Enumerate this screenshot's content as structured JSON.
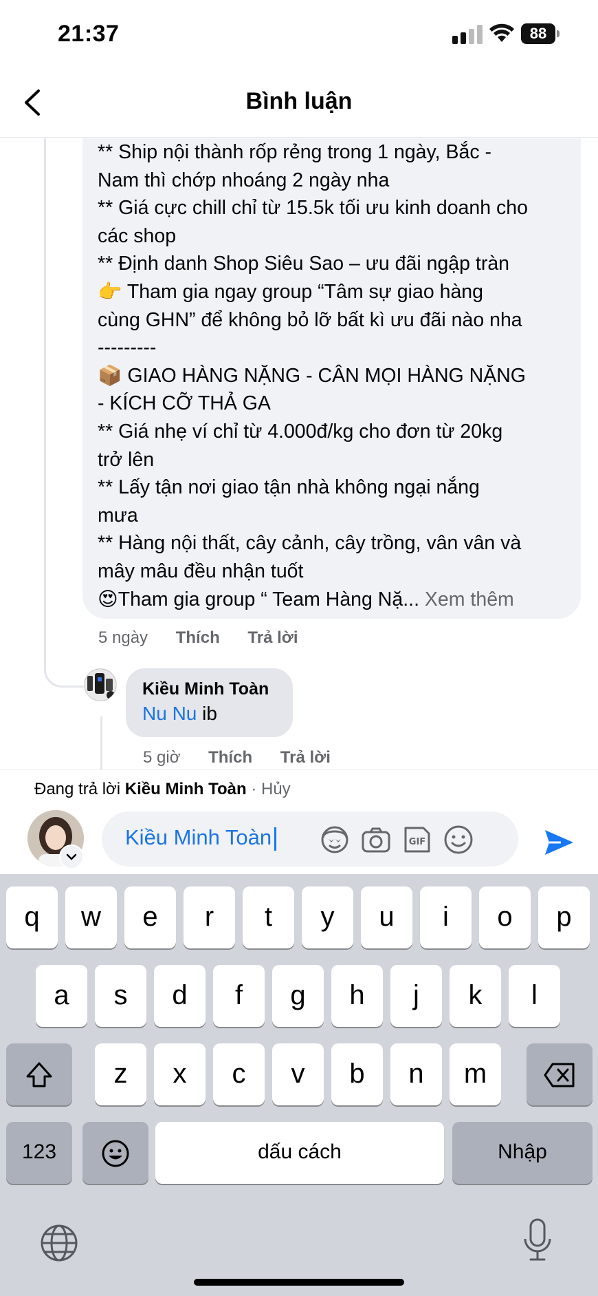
{
  "status_bar": {
    "time": "21:37",
    "battery": "88"
  },
  "header": {
    "title": "Bình luận"
  },
  "main_comment": {
    "lines": [
      "** Ship nội thành rốp rẻng trong 1 ngày, Bắc -",
      "Nam thì chớp nhoáng 2 ngày nha",
      "** Giá cực chill chỉ từ 15.5k tối ưu kinh doanh cho",
      "các shop",
      "** Định danh Shop Siêu Sao – ưu đãi ngập tràn",
      "👉 Tham gia ngay group “Tâm sự giao hàng",
      "cùng GHN” để không bỏ lỡ bất kì ưu đãi nào nha",
      "---------",
      "📦 GIAO HÀNG NẶNG - CÂN MỌI HÀNG NẶNG",
      "- KÍCH CỠ THẢ GA",
      "** Giá nhẹ ví chỉ từ 4.000đ/kg cho đơn từ 20kg",
      "trở lên",
      "**  Lấy tận nơi giao tận nhà không ngại nắng",
      "mưa",
      "** Hàng nội thất, cây cảnh, cây trồng, vân vân và",
      "mây mâu đều nhận tuốt",
      "😍Tham gia group “ Team Hàng Nặ..."
    ],
    "see_more": "Xem thêm",
    "time": "5 ngày",
    "like": "Thích",
    "reply": "Trả lời"
  },
  "reply_comment": {
    "author": "Kiều Minh Toàn",
    "mention": "Nu Nu",
    "text": " ib",
    "time": "5 giờ",
    "like": "Thích",
    "reply": "Trả lời"
  },
  "composer": {
    "replying_prefix": "Đang trả lời ",
    "replying_name": "Kiều Minh Toàn",
    "separator": " · ",
    "cancel": "Hủy",
    "input_value": "Kiều Minh Toàn",
    "accent": "#1877f2"
  },
  "keyboard": {
    "row1": [
      "q",
      "w",
      "e",
      "r",
      "t",
      "y",
      "u",
      "i",
      "o",
      "p"
    ],
    "row2": [
      "a",
      "s",
      "d",
      "f",
      "g",
      "h",
      "j",
      "k",
      "l"
    ],
    "row3": [
      "z",
      "x",
      "c",
      "v",
      "b",
      "n",
      "m"
    ],
    "numbers_key": "123",
    "space_key": "dấu cách",
    "return_key": "Nhập"
  }
}
